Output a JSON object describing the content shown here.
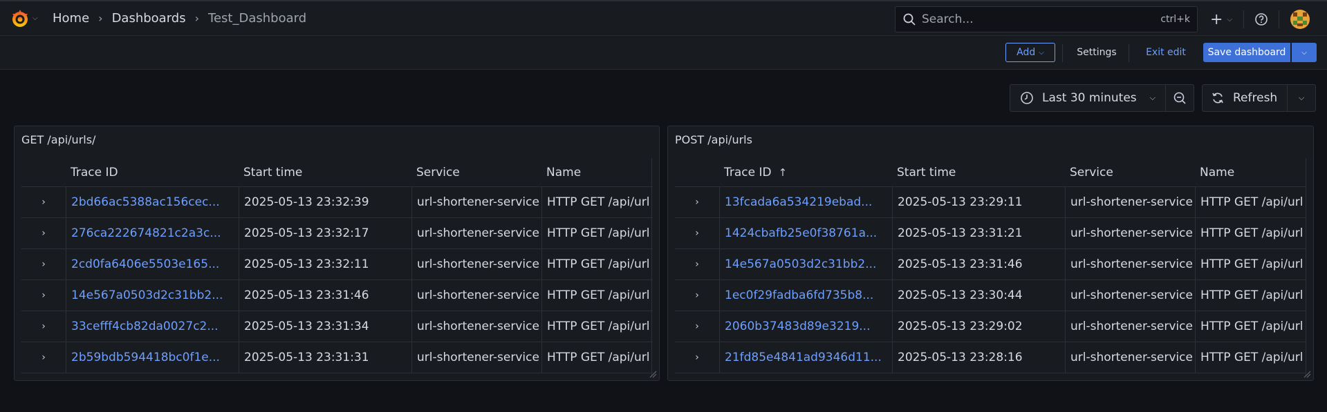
{
  "breadcrumb": {
    "home": "Home",
    "dashboards": "Dashboards",
    "current": "Test_Dashboard"
  },
  "search": {
    "placeholder": "Search...",
    "shortcut": "ctrl+k"
  },
  "toolbar": {
    "add_label": "Add",
    "settings_label": "Settings",
    "exit_label": "Exit edit",
    "save_label": "Save dashboard"
  },
  "timepicker": {
    "range_label": "Last 30 minutes"
  },
  "refresh": {
    "label": "Refresh"
  },
  "colors": {
    "accent": "#6e9fff",
    "primary_button": "#3d71d9",
    "background": "#111217",
    "panel": "#181b1f"
  },
  "panels": [
    {
      "title": "GET /api/urls/",
      "columns": [
        "Trace ID",
        "Start time",
        "Service",
        "Name"
      ],
      "sorted_column": "",
      "rows": [
        {
          "trace_id": "2bd66ac5388ac156cec...",
          "start": "2025-05-13 23:32:39",
          "service": "url-shortener-service",
          "name": "HTTP GET /api/url"
        },
        {
          "trace_id": "276ca222674821c2a3c...",
          "start": "2025-05-13 23:32:17",
          "service": "url-shortener-service",
          "name": "HTTP GET /api/url"
        },
        {
          "trace_id": "2cd0fa6406e5503e165...",
          "start": "2025-05-13 23:32:11",
          "service": "url-shortener-service",
          "name": "HTTP GET /api/url"
        },
        {
          "trace_id": "14e567a0503d2c31bb2...",
          "start": "2025-05-13 23:31:46",
          "service": "url-shortener-service",
          "name": "HTTP GET /api/url"
        },
        {
          "trace_id": "33cefff4cb82da0027c2...",
          "start": "2025-05-13 23:31:34",
          "service": "url-shortener-service",
          "name": "HTTP GET /api/url"
        },
        {
          "trace_id": "2b59bdb594418bc0f1e...",
          "start": "2025-05-13 23:31:31",
          "service": "url-shortener-service",
          "name": "HTTP GET /api/url"
        }
      ]
    },
    {
      "title": "POST /api/urls",
      "columns": [
        "Trace ID",
        "Start time",
        "Service",
        "Name"
      ],
      "sorted_column": "Trace ID",
      "rows": [
        {
          "trace_id": "13fcada6a534219ebad...",
          "start": "2025-05-13 23:29:11",
          "service": "url-shortener-service",
          "name": "HTTP GET /api/url"
        },
        {
          "trace_id": "1424cbafb25e0f38761a...",
          "start": "2025-05-13 23:31:21",
          "service": "url-shortener-service",
          "name": "HTTP GET /api/url"
        },
        {
          "trace_id": "14e567a0503d2c31bb2...",
          "start": "2025-05-13 23:31:46",
          "service": "url-shortener-service",
          "name": "HTTP GET /api/url"
        },
        {
          "trace_id": "1ec0f29fadba6fd735b8...",
          "start": "2025-05-13 23:30:44",
          "service": "url-shortener-service",
          "name": "HTTP GET /api/url"
        },
        {
          "trace_id": "2060b37483d89e3219...",
          "start": "2025-05-13 23:29:02",
          "service": "url-shortener-service",
          "name": "HTTP GET /api/url"
        },
        {
          "trace_id": "21fd85e4841ad9346d11...",
          "start": "2025-05-13 23:28:16",
          "service": "url-shortener-service",
          "name": "HTTP GET /api/url"
        }
      ]
    }
  ]
}
